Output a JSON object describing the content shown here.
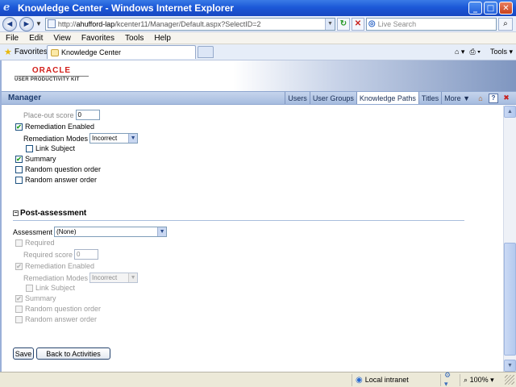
{
  "window": {
    "title": "Knowledge Center - Windows Internet Explorer",
    "minimize_glyph": "_",
    "maximize_glyph": "□",
    "close_glyph": "✕"
  },
  "addressbar": {
    "url_prefix": "http://",
    "url_host": "ahufford-lap",
    "url_path": "/kcenter11/Manager/Default.aspx?SelectID=2",
    "search_placeholder": "Live Search"
  },
  "menubar": {
    "items": [
      "File",
      "Edit",
      "View",
      "Favorites",
      "Tools",
      "Help"
    ]
  },
  "tabbar": {
    "favorites_label": "Favorites",
    "active_tab_label": "Knowledge Center",
    "tools_label": "Tools"
  },
  "header": {
    "logo_brand": "ORACLE",
    "logo_product": "USER PRODUCTIVITY KIT"
  },
  "managerbar": {
    "title": "Manager",
    "links": [
      "Users",
      "User Groups",
      "Knowledge Paths",
      "Titles",
      "More ▼"
    ],
    "active_link": "Knowledge Paths"
  },
  "pre_assessment": {
    "placeout_score_label": "Place-out score",
    "placeout_score_value": "0",
    "remediation_enabled_label": "Remediation Enabled",
    "remediation_enabled_checked": true,
    "remediation_modes_label": "Remediation Modes",
    "remediation_modes_value": "Incorrect",
    "link_subject_label": "Link Subject",
    "link_subject_checked": false,
    "summary_label": "Summary",
    "summary_checked": true,
    "random_question_label": "Random question order",
    "random_question_checked": false,
    "random_answer_label": "Random answer order",
    "random_answer_checked": false
  },
  "post_assessment": {
    "section_title": "Post-assessment",
    "assessment_label": "Assessment",
    "assessment_value": "(None)",
    "required_label": "Required",
    "required_checked": false,
    "required_score_label": "Required score",
    "required_score_value": "0",
    "remediation_enabled_label": "Remediation Enabled",
    "remediation_enabled_checked": true,
    "remediation_modes_label": "Remediation Modes",
    "remediation_modes_value": "Incorrect",
    "link_subject_label": "Link Subject",
    "link_subject_checked": false,
    "summary_label": "Summary",
    "summary_checked": true,
    "random_question_label": "Random question order",
    "random_question_checked": false,
    "random_answer_label": "Random answer order",
    "random_answer_checked": false
  },
  "buttons": {
    "save_label": "Save",
    "back_label": "Back to Activities"
  },
  "statusbar": {
    "zone_label": "Local intranet",
    "zoom_label": "100%"
  },
  "icons": {
    "check_glyph": "✔",
    "dropdown_glyph": "▼"
  }
}
